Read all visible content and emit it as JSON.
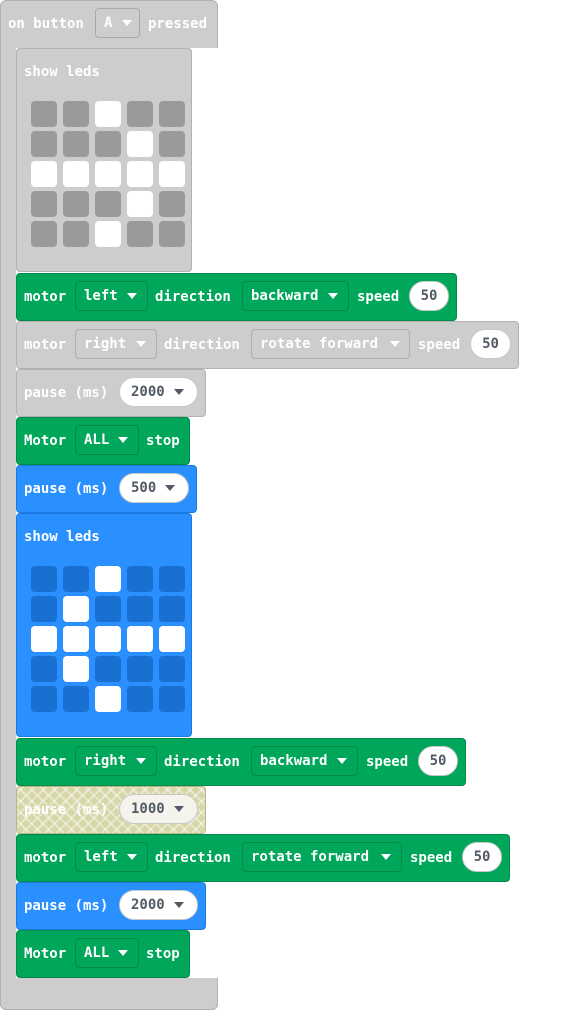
{
  "event": {
    "prefix": "on button",
    "button": "A",
    "suffix": "pressed"
  },
  "show_leds_1": {
    "label": "show leds",
    "grid": [
      [
        0,
        0,
        1,
        0,
        0
      ],
      [
        0,
        0,
        0,
        1,
        0
      ],
      [
        1,
        1,
        1,
        1,
        1
      ],
      [
        0,
        0,
        0,
        1,
        0
      ],
      [
        0,
        0,
        1,
        0,
        0
      ]
    ]
  },
  "motor1": {
    "motor_label": "motor",
    "side": "left",
    "direction_label": "direction",
    "direction": "backward",
    "speed_label": "speed",
    "speed": "50"
  },
  "motor2": {
    "motor_label": "motor",
    "side": "right",
    "direction_label": "direction",
    "direction": "rotate forward",
    "speed_label": "speed",
    "speed": "50"
  },
  "pause1": {
    "label": "pause (ms)",
    "value": "2000"
  },
  "stop1": {
    "label": "Motor",
    "target": "ALL",
    "suffix": "stop"
  },
  "pause2": {
    "label": "pause (ms)",
    "value": "500"
  },
  "show_leds_2": {
    "label": "show leds",
    "grid": [
      [
        0,
        0,
        1,
        0,
        0
      ],
      [
        0,
        1,
        0,
        0,
        0
      ],
      [
        1,
        1,
        1,
        1,
        1
      ],
      [
        0,
        1,
        0,
        0,
        0
      ],
      [
        0,
        0,
        1,
        0,
        0
      ]
    ]
  },
  "motor3": {
    "motor_label": "motor",
    "side": "right",
    "direction_label": "direction",
    "direction": "backward",
    "speed_label": "speed",
    "speed": "50"
  },
  "pause3": {
    "label": "pause (ms)",
    "value": "1000"
  },
  "motor4": {
    "motor_label": "motor",
    "side": "left",
    "direction_label": "direction",
    "direction": "rotate forward",
    "speed_label": "speed",
    "speed": "50"
  },
  "pause4": {
    "label": "pause (ms)",
    "value": "2000"
  },
  "stop2": {
    "label": "Motor",
    "target": "ALL",
    "suffix": "stop"
  },
  "colors": {
    "green": "#00a65a",
    "gray": "#cdcdcd",
    "blue": "#2b90ff",
    "led_on": "#ffffff",
    "led_off_gray": "#9a9a9a",
    "led_off_blue": "#1a70d0"
  }
}
